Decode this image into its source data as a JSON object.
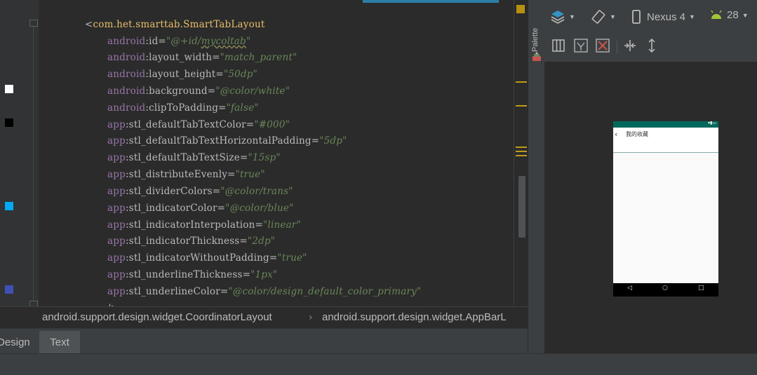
{
  "editor": {
    "lines": [
      {
        "indent": 66,
        "segments": [
          {
            "cls": "punct",
            "text": "<"
          },
          {
            "cls": "tag",
            "text": "com.het.smarttab.SmartTabLayout"
          }
        ]
      },
      {
        "indent": 98,
        "segments": [
          {
            "cls": "ns",
            "text": "android"
          },
          {
            "cls": "attr",
            "text": ":id="
          },
          {
            "cls": "str",
            "text": "\"@+id/"
          },
          {
            "cls": "str str-ul",
            "text": "mycoltab"
          },
          {
            "cls": "str",
            "text": "\""
          }
        ]
      },
      {
        "indent": 98,
        "segments": [
          {
            "cls": "ns",
            "text": "android"
          },
          {
            "cls": "attr",
            "text": ":layout_width="
          },
          {
            "cls": "str",
            "text": "\"match_parent\""
          }
        ]
      },
      {
        "indent": 98,
        "segments": [
          {
            "cls": "ns",
            "text": "android"
          },
          {
            "cls": "attr",
            "text": ":layout_height="
          },
          {
            "cls": "str",
            "text": "\"50dp\""
          }
        ]
      },
      {
        "indent": 98,
        "segments": [
          {
            "cls": "ns",
            "text": "android"
          },
          {
            "cls": "attr",
            "text": ":background="
          },
          {
            "cls": "str",
            "text": "\"@color/white\""
          }
        ]
      },
      {
        "indent": 98,
        "segments": [
          {
            "cls": "ns",
            "text": "android"
          },
          {
            "cls": "attr",
            "text": ":clipToPadding="
          },
          {
            "cls": "str",
            "text": "\"false\""
          }
        ]
      },
      {
        "indent": 98,
        "segments": [
          {
            "cls": "ns",
            "text": "app"
          },
          {
            "cls": "attr",
            "text": ":stl_defaultTabTextColor="
          },
          {
            "cls": "str",
            "text": "\"#000\""
          }
        ]
      },
      {
        "indent": 98,
        "segments": [
          {
            "cls": "ns",
            "text": "app"
          },
          {
            "cls": "attr",
            "text": ":stl_defaultTabTextHorizontalPadding="
          },
          {
            "cls": "str",
            "text": "\"5dp\""
          }
        ]
      },
      {
        "indent": 98,
        "segments": [
          {
            "cls": "ns",
            "text": "app"
          },
          {
            "cls": "attr",
            "text": ":stl_defaultTabTextSize="
          },
          {
            "cls": "str",
            "text": "\"15sp\""
          }
        ]
      },
      {
        "indent": 98,
        "segments": [
          {
            "cls": "ns",
            "text": "app"
          },
          {
            "cls": "attr",
            "text": ":stl_distributeEvenly="
          },
          {
            "cls": "str",
            "text": "\"true\""
          }
        ]
      },
      {
        "indent": 98,
        "segments": [
          {
            "cls": "ns",
            "text": "app"
          },
          {
            "cls": "attr",
            "text": ":stl_dividerColors="
          },
          {
            "cls": "str",
            "text": "\"@color/trans\""
          }
        ]
      },
      {
        "indent": 98,
        "segments": [
          {
            "cls": "ns",
            "text": "app"
          },
          {
            "cls": "attr",
            "text": ":stl_indicatorColor="
          },
          {
            "cls": "str",
            "text": "\"@color/blue\""
          }
        ]
      },
      {
        "indent": 98,
        "segments": [
          {
            "cls": "ns",
            "text": "app"
          },
          {
            "cls": "attr",
            "text": ":stl_indicatorInterpolation="
          },
          {
            "cls": "str",
            "text": "\"linear\""
          }
        ]
      },
      {
        "indent": 98,
        "segments": [
          {
            "cls": "ns",
            "text": "app"
          },
          {
            "cls": "attr",
            "text": ":stl_indicatorThickness="
          },
          {
            "cls": "str",
            "text": "\"2dp\""
          }
        ]
      },
      {
        "indent": 98,
        "segments": [
          {
            "cls": "ns",
            "text": "app"
          },
          {
            "cls": "attr",
            "text": ":stl_indicatorWithoutPadding="
          },
          {
            "cls": "str",
            "text": "\"true\""
          }
        ]
      },
      {
        "indent": 98,
        "segments": [
          {
            "cls": "ns",
            "text": "app"
          },
          {
            "cls": "attr",
            "text": ":stl_underlineThickness="
          },
          {
            "cls": "str",
            "text": "\"1px\""
          }
        ]
      },
      {
        "indent": 98,
        "segments": [
          {
            "cls": "ns",
            "text": "app"
          },
          {
            "cls": "attr",
            "text": ":stl_underlineColor="
          },
          {
            "cls": "str",
            "text": "\"@color/design_default_color_primary\""
          }
        ]
      },
      {
        "indent": 98,
        "segments": [
          {
            "cls": "punct",
            "text": "/>"
          }
        ]
      }
    ],
    "gutter_swatches": [
      {
        "color": "#ffffff"
      },
      {
        "color": "#000000"
      },
      {
        "color": "#03a9f4"
      },
      {
        "color": "#3f51b5"
      }
    ]
  },
  "breadcrumb": {
    "first": "android.support.design.widget.CoordinatorLayout",
    "separator": "›",
    "second": "android.support.design.widget.AppBarL"
  },
  "bottom_tabs": {
    "design": "Design",
    "text": "Text"
  },
  "palette": {
    "label": "Palette"
  },
  "design_toolbar": {
    "device": "Nexus 4",
    "api_level": "28",
    "accent": "#a4c639"
  },
  "phone_preview": {
    "title": "我的收藏",
    "back": "‹",
    "status_icons": "▾▮▭"
  }
}
